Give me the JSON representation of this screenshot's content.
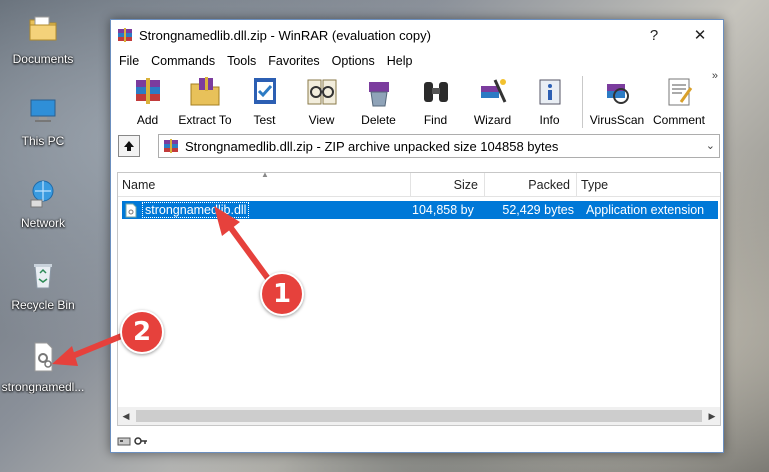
{
  "desktop": {
    "icons": [
      {
        "label": "Documents",
        "icon": "documents-folder-icon"
      },
      {
        "label": "This PC",
        "icon": "this-pc-icon"
      },
      {
        "label": "Network",
        "icon": "network-icon"
      },
      {
        "label": "Recycle Bin",
        "icon": "recycle-bin-icon"
      },
      {
        "label": "strongnamedl...",
        "icon": "dll-file-icon"
      }
    ]
  },
  "window": {
    "title": "Strongnamedlib.dll.zip - WinRAR (evaluation copy)",
    "help_btn": "?",
    "close_btn": "✕"
  },
  "menu": [
    "File",
    "Commands",
    "Tools",
    "Favorites",
    "Options",
    "Help"
  ],
  "toolbar": [
    "Add",
    "Extract To",
    "Test",
    "View",
    "Delete",
    "Find",
    "Wizard",
    "Info",
    "VirusScan",
    "Comment"
  ],
  "toolbar_more": "»",
  "address": {
    "text": "Strongnamedlib.dll.zip - ZIP archive unpacked size 104858 bytes"
  },
  "columns": [
    "Name",
    "Size",
    "Packed",
    "Type"
  ],
  "files": [
    {
      "name": "strongnamedlib.dll",
      "size": "104,858 by",
      "packed": "52,429 bytes",
      "type": "Application extension"
    }
  ],
  "badges": [
    "1",
    "2"
  ],
  "colors": {
    "selection": "#0078d7",
    "badge": "#e6413c"
  }
}
